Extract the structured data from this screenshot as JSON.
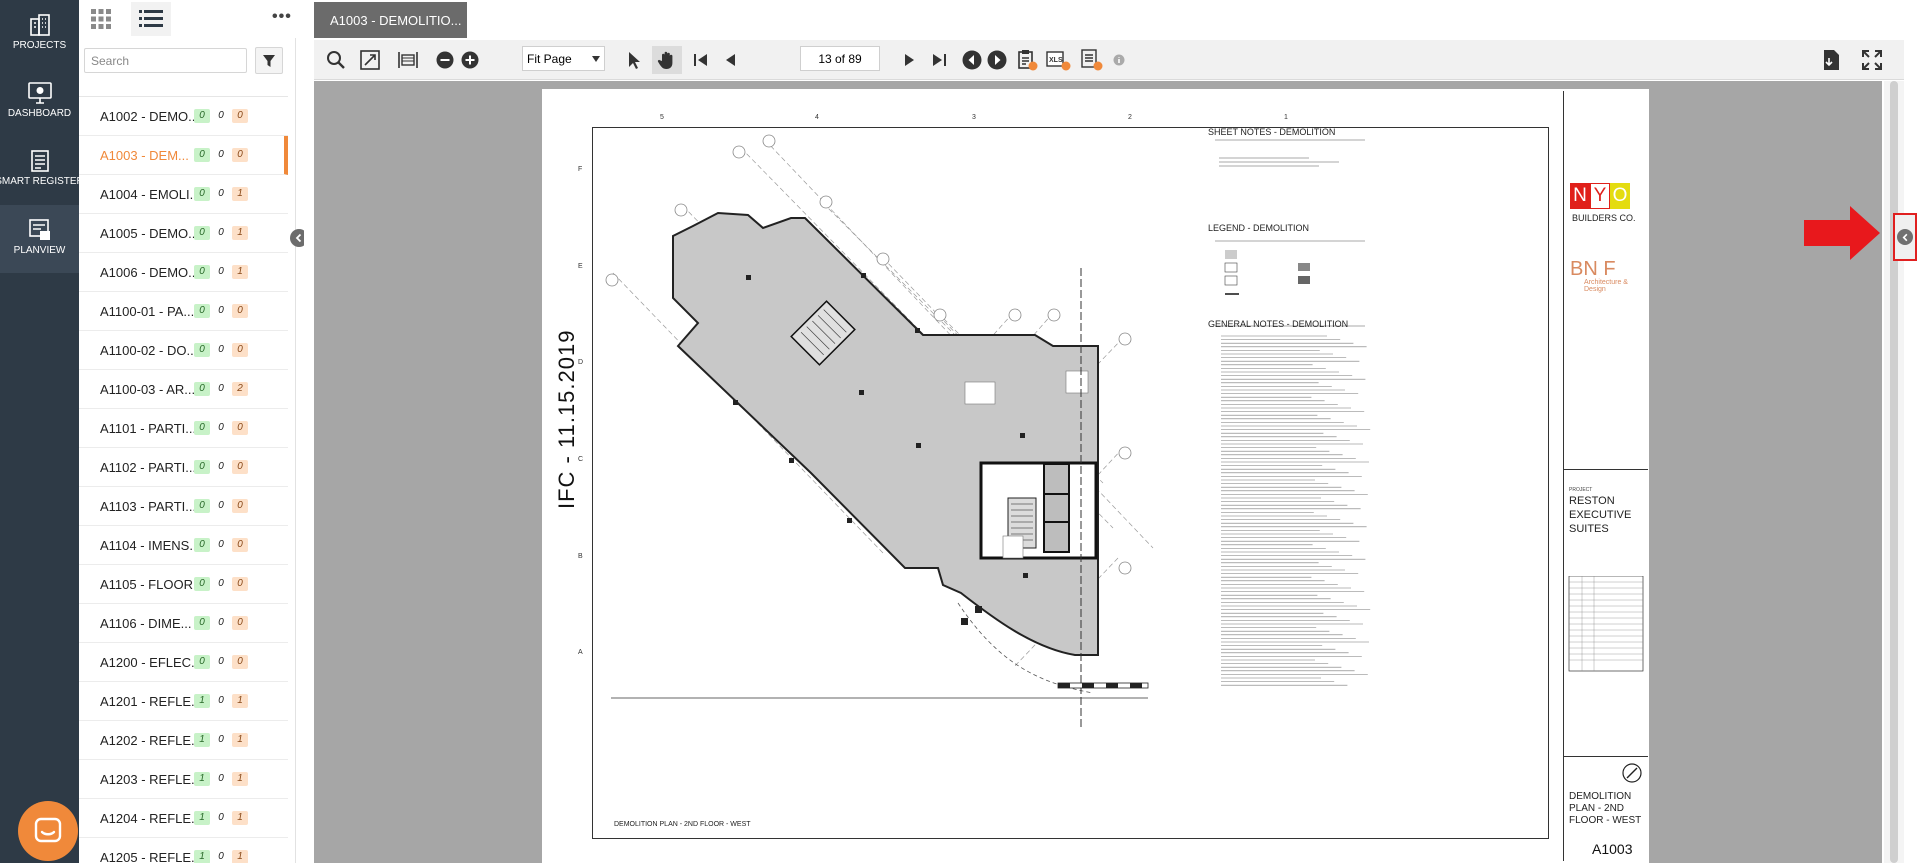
{
  "nav": {
    "items": [
      {
        "label": "PROJECTS",
        "icon": "projects-building-icon"
      },
      {
        "label": "DASHBOARD",
        "icon": "dashboard-monitor-icon"
      },
      {
        "label": "SMART REGISTER",
        "icon": "smart-register-icon"
      },
      {
        "label": "PLANVIEW",
        "icon": "planview-icon"
      }
    ],
    "active": "PLANVIEW"
  },
  "panel": {
    "search_placeholder": "Search",
    "more_label": "•••",
    "sheets": [
      {
        "name": "A1002 - DEMO...",
        "counts": [
          "0",
          "0",
          "0"
        ],
        "active": false
      },
      {
        "name": "A1003 - DEM...",
        "counts": [
          "0",
          "0",
          "0"
        ],
        "active": true
      },
      {
        "name": "A1004 - EMOLI...",
        "counts": [
          "0",
          "0",
          "1"
        ],
        "active": false
      },
      {
        "name": "A1005 - DEMO...",
        "counts": [
          "0",
          "0",
          "1"
        ],
        "active": false
      },
      {
        "name": "A1006 - DEMO...",
        "counts": [
          "0",
          "0",
          "1"
        ],
        "active": false
      },
      {
        "name": "A1100-01 - PA...",
        "counts": [
          "0",
          "0",
          "0"
        ],
        "active": false
      },
      {
        "name": "A1100-02 - DO...",
        "counts": [
          "0",
          "0",
          "0"
        ],
        "active": false
      },
      {
        "name": "A1100-03 - AR...",
        "counts": [
          "0",
          "0",
          "2"
        ],
        "active": false
      },
      {
        "name": "A1101 - PARTI...",
        "counts": [
          "0",
          "0",
          "0"
        ],
        "active": false
      },
      {
        "name": "A1102 - PARTI...",
        "counts": [
          "0",
          "0",
          "0"
        ],
        "active": false
      },
      {
        "name": "A1103 - PARTI...",
        "counts": [
          "0",
          "0",
          "0"
        ],
        "active": false
      },
      {
        "name": "A1104 - IMENS...",
        "counts": [
          "0",
          "0",
          "0"
        ],
        "active": false
      },
      {
        "name": "A1105 - FLOOR",
        "counts": [
          "0",
          "0",
          "0"
        ],
        "active": false
      },
      {
        "name": "A1106 - DIME...",
        "counts": [
          "0",
          "0",
          "0"
        ],
        "active": false
      },
      {
        "name": "A1200 - EFLEC...",
        "counts": [
          "0",
          "0",
          "0"
        ],
        "active": false
      },
      {
        "name": "A1201 - REFLE...",
        "counts": [
          "1",
          "0",
          "1"
        ],
        "active": false
      },
      {
        "name": "A1202 - REFLE...",
        "counts": [
          "1",
          "0",
          "1"
        ],
        "active": false
      },
      {
        "name": "A1203 - REFLE...",
        "counts": [
          "1",
          "0",
          "1"
        ],
        "active": false
      },
      {
        "name": "A1204 - REFLE...",
        "counts": [
          "1",
          "0",
          "1"
        ],
        "active": false
      },
      {
        "name": "A1205 - REFLE...",
        "counts": [
          "1",
          "0",
          "1"
        ],
        "active": false
      }
    ]
  },
  "viewer": {
    "tab_label": "A1003 - DEMOLITIO...",
    "zoom_mode": "Fit Page",
    "page_indicator": "13 of 89"
  },
  "drawing": {
    "date_stamp": "IFC - 11.15.2019",
    "sheet_notes_title": "SHEET NOTES - DEMOLITION",
    "legend_title": "LEGEND - DEMOLITION",
    "general_notes_title": "GENERAL NOTES - DEMOLITION",
    "logo_letters": [
      "N",
      "Y",
      "O"
    ],
    "logo_subtitle": "BUILDERS CO.",
    "bnf_letters": "BN F",
    "bnf_sub": "Architecture & Design",
    "project_label": "PROJECT",
    "project_name": "RESTON EXECUTIVE SUITES",
    "sheet_title": "DEMOLITION PLAN - 2ND FLOOR - WEST",
    "sheet_number": "A1003",
    "plan_caption": "DEMOLITION PLAN - 2ND FLOOR - WEST",
    "column_ticks": [
      "5",
      "4",
      "3",
      "2",
      "1"
    ],
    "row_ticks": [
      "F",
      "E",
      "D",
      "C",
      "B",
      "A"
    ]
  },
  "colors": {
    "nav_bg": "#2e3a46",
    "accent_orange": "#f0893a",
    "annotation_red": "#e02020",
    "canvas_gray": "#a6a6a6"
  }
}
